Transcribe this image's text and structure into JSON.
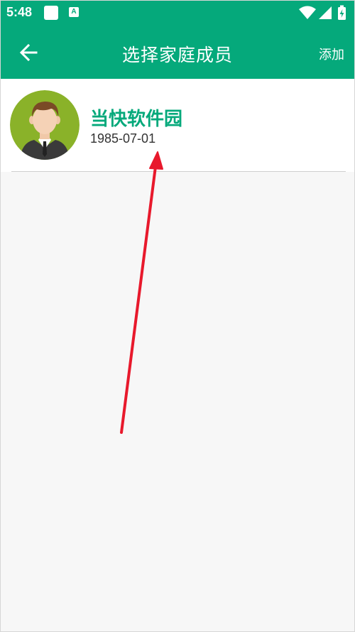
{
  "status_bar": {
    "time": "5:48",
    "app_badge_letter": "A",
    "icons": [
      "notification-square-icon",
      "app-badge-icon",
      "wifi-icon",
      "signal-icon",
      "battery-icon"
    ]
  },
  "header": {
    "title": "选择家庭成员",
    "add_label": "添加",
    "back_icon": "back-arrow-icon"
  },
  "members": [
    {
      "name": "当快软件园",
      "birth_date": "1985-07-01",
      "avatar_icon": "male-avatar-icon"
    }
  ],
  "colors": {
    "primary": "#05a97b",
    "background": "#f7f7f7",
    "annotation_arrow": "#e8192c"
  }
}
